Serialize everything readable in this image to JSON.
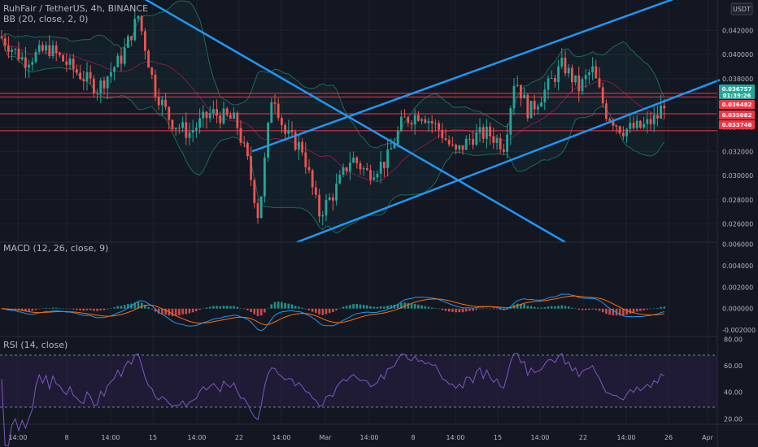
{
  "header": {
    "symbol_line": "RuhFair / TetherUS, 4h, BINANCE",
    "indicator_bb": "BB (20, close, 2, 0)",
    "currency_badge": "USDT"
  },
  "colors": {
    "background": "#131722",
    "grid": "#1e222d",
    "up": "#26a69a",
    "down": "#ef5350",
    "trendline": "#2196f3",
    "level": "#f23645",
    "bb": "#1a6b5a",
    "bb_basis": "#c2185b",
    "macd_line": "#2196f3",
    "signal_line": "#ff6d00",
    "rsi_line": "#7e57c2",
    "rsi_band": "#2a1f45"
  },
  "chart_data": [
    {
      "type": "candlestick",
      "title": "RuhFair / TetherUS, 4h, BINANCE",
      "y_axis_labels": [
        "0.026000",
        "0.028000",
        "0.030000",
        "0.032000",
        "0.034000",
        "0.036000",
        "0.038000",
        "0.040000",
        "0.042000"
      ],
      "ylim": [
        0.0245,
        0.0445
      ],
      "x_axis_labels": [
        "14:00",
        "8",
        "14:00",
        "15",
        "14:00",
        "22",
        "14:00",
        "Mar",
        "14:00",
        "8",
        "14:00",
        "15",
        "14:00",
        "22",
        "14:00",
        "26",
        "Apr"
      ],
      "price_tags": [
        {
          "value": "0.036757",
          "sub": "01:39:26",
          "color": "#26a69a"
        },
        {
          "value": "0.036482",
          "color": "#f23645"
        },
        {
          "value": "0.035082",
          "color": "#f23645"
        },
        {
          "value": "0.033746",
          "color": "#f23645"
        }
      ],
      "horizontal_levels": [
        0.0368,
        0.0365,
        0.0351,
        0.0337
      ],
      "last_price": 0.036757,
      "countdown": "01:39:26"
    },
    {
      "type": "line",
      "title": "MACD (12, 26, close, 9)",
      "y_axis_labels": [
        "-0.002000",
        "0.000000",
        "0.002000",
        "0.004000",
        "0.006000"
      ],
      "ylim": [
        -0.0026,
        0.0062
      ]
    },
    {
      "type": "line",
      "title": "RSI (14, close)",
      "y_axis_labels": [
        "20.00",
        "40.00",
        "60.00",
        "80.00"
      ],
      "ylim": [
        16,
        82
      ],
      "bands": [
        30,
        70
      ]
    }
  ]
}
